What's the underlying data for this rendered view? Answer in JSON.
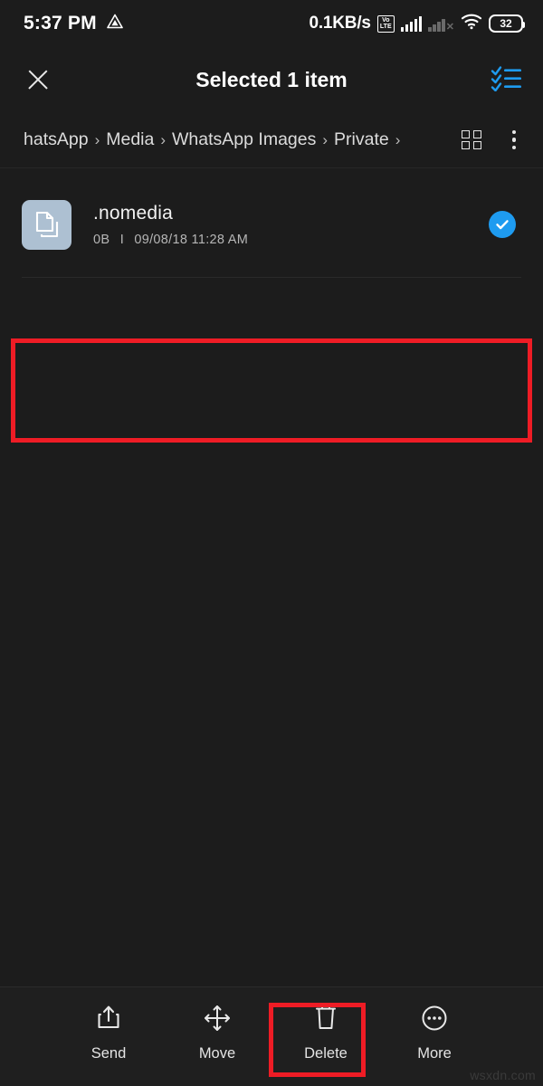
{
  "status_bar": {
    "time": "5:37 PM",
    "alarm_icon": "triangle-app-icon",
    "net_speed": "0.1KB/s",
    "volte_top": "Vo",
    "volte_bottom": "LTE",
    "sim1_signal": "4 of 5 bars",
    "sim2_signal": "no service",
    "wifi": "wifi-connected",
    "battery_level": "32"
  },
  "app_bar": {
    "close_label": "close-icon",
    "title": "Selected 1 item",
    "select_all_label": "select-all-icon"
  },
  "breadcrumb": {
    "items": [
      {
        "label": "hatsApp"
      },
      {
        "label": "Media"
      },
      {
        "label": "WhatsApp Images"
      },
      {
        "label": "Private"
      }
    ],
    "separator": "›",
    "grid_view_label": "grid-view-icon",
    "overflow_label": "more-options-icon"
  },
  "file_list": {
    "rows": [
      {
        "name": ".nomedia",
        "size": "0B",
        "separator": "I",
        "date": "09/08/18 11:28 AM",
        "selected": true,
        "icon": "document-file-icon"
      }
    ]
  },
  "bottom_bar": {
    "actions": [
      {
        "label": "Send",
        "icon": "share-upload-icon",
        "highlighted": false
      },
      {
        "label": "Move",
        "icon": "move-arrows-icon",
        "highlighted": false
      },
      {
        "label": "Delete",
        "icon": "trash-can-icon",
        "highlighted": true
      },
      {
        "label": "More",
        "icon": "more-circle-icon",
        "highlighted": false
      }
    ]
  },
  "annotations": {
    "file_row_highlight_color": "#ee1c25",
    "delete_highlight_color": "#ee1c25"
  },
  "watermark": {
    "text": "wsxdn.com"
  },
  "colors": {
    "background": "#1c1c1c",
    "accent_blue": "#1e9bf0",
    "file_icon_bg": "#adc0d2",
    "highlight_red": "#ee1c25"
  }
}
